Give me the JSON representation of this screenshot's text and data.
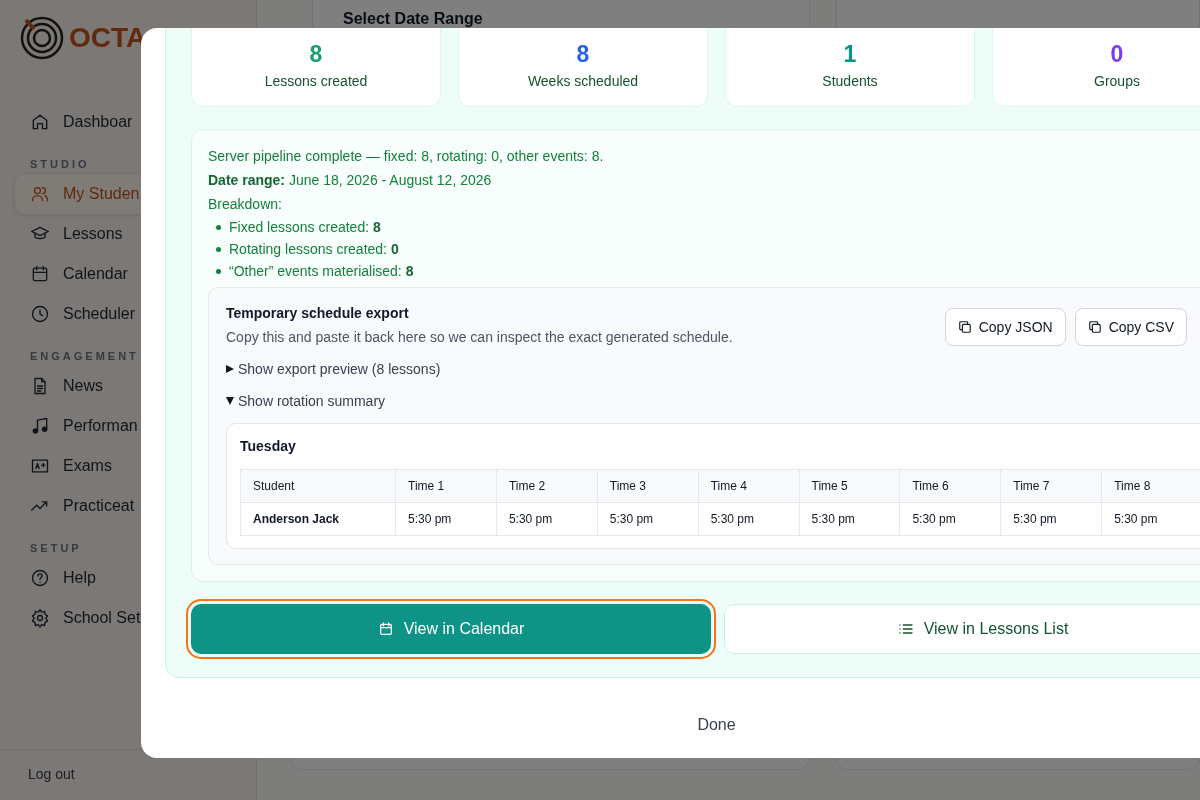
{
  "sidebar": {
    "logo": "OCTA",
    "items": [
      {
        "kind": "item",
        "label": "Dashboar",
        "selected": false
      },
      {
        "kind": "header",
        "label": "STUDIO"
      },
      {
        "kind": "item",
        "label": "My Studen",
        "selected": true
      },
      {
        "kind": "item",
        "label": "Lessons",
        "selected": false
      },
      {
        "kind": "item",
        "label": "Calendar",
        "selected": false
      },
      {
        "kind": "item",
        "label": "Scheduler",
        "selected": false
      },
      {
        "kind": "header",
        "label": "ENGAGEMENT"
      },
      {
        "kind": "item",
        "label": "News",
        "selected": false
      },
      {
        "kind": "item",
        "label": "Performan",
        "selected": false
      },
      {
        "kind": "item",
        "label": "Exams",
        "selected": false
      },
      {
        "kind": "item",
        "label": "Practiceat",
        "selected": false
      },
      {
        "kind": "header",
        "label": "SETUP"
      },
      {
        "kind": "item",
        "label": "Help",
        "selected": false
      },
      {
        "kind": "item",
        "label": "School Set",
        "selected": false
      }
    ],
    "logout": "Log out"
  },
  "background": {
    "title": "Select Date Range"
  },
  "modal": {
    "stats": [
      {
        "value": "8",
        "label": "Lessons created",
        "color": "#15a16b"
      },
      {
        "value": "8",
        "label": "Weeks scheduled",
        "color": "#2563eb"
      },
      {
        "value": "1",
        "label": "Students",
        "color": "#0d9488"
      },
      {
        "value": "0",
        "label": "Groups",
        "color": "#7c3aed"
      }
    ],
    "summary": {
      "pipeline": "Server pipeline complete — fixed: 8, rotating: 0, other events: 8.",
      "date_range": "**Date range:** June 18, 2026 - August 12, 2026",
      "breakdown_title": "Breakdown:",
      "breakdown": [
        "Fixed lessons created: **8**",
        "Rotating lessons created: **0**",
        "“Other” events materialised: **8**"
      ]
    },
    "export": {
      "title": "Temporary schedule export",
      "description": "Copy this and paste it back here so we can inspect the exact generated schedule.",
      "buttons": [
        "Copy JSON",
        "Copy CSV"
      ],
      "disclosures": [
        {
          "label": "Show export preview (8 lessons)",
          "expanded": false
        },
        {
          "label": "Show rotation summary",
          "expanded": true
        }
      ],
      "rotation": {
        "day": "Tuesday",
        "columns": [
          "Student",
          "Time 1",
          "Time 2",
          "Time 3",
          "Time 4",
          "Time 5",
          "Time 6",
          "Time 7",
          "Time 8"
        ],
        "rows": [
          [
            "Anderson Jack",
            "5:30 pm",
            "5:30 pm",
            "5:30 pm",
            "5:30 pm",
            "5:30 pm",
            "5:30 pm",
            "5:30 pm",
            "5:30 pm"
          ]
        ]
      }
    },
    "actions": [
      {
        "label": "View in Calendar",
        "kind": "primary",
        "focused": true
      },
      {
        "label": "View in Lessons List",
        "kind": "secondary",
        "focused": false
      }
    ],
    "done": "Done"
  }
}
